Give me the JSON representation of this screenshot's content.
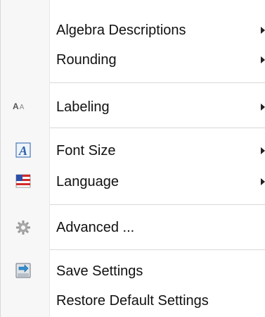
{
  "menu": {
    "items": [
      {
        "label": "Algebra Descriptions",
        "submenu": true
      },
      {
        "label": "Rounding",
        "submenu": true
      },
      {
        "label": "Labeling",
        "submenu": true,
        "icon": "font-aa-icon"
      },
      {
        "label": "Font Size",
        "submenu": true,
        "icon": "font-size-icon"
      },
      {
        "label": "Language",
        "submenu": true,
        "icon": "language-flag-icon"
      },
      {
        "label": "Advanced ...",
        "submenu": false,
        "icon": "gear-icon"
      },
      {
        "label": "Save Settings",
        "submenu": false,
        "icon": "save-settings-icon"
      },
      {
        "label": "Restore Default Settings",
        "submenu": false
      }
    ],
    "labeling_icon_text": {
      "big": "A",
      "small": "A"
    },
    "font_size_icon_text": "A"
  }
}
